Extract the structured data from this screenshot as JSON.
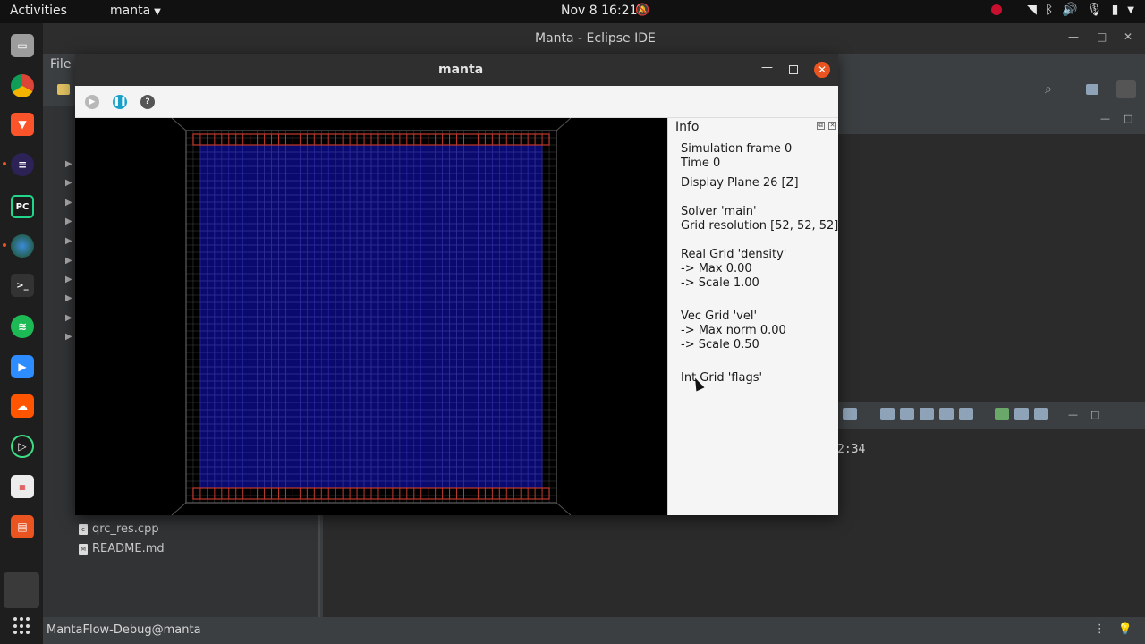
{
  "topbar": {
    "activities": "Activities",
    "app_menu": "manta",
    "clock": "Nov 8  16:21"
  },
  "eclipse": {
    "title": "Manta - Eclipse IDE",
    "menu_file": "File",
    "explorer_files": [
      {
        "name": "qrc_res.cpp",
        "icon": "c-file-icon"
      },
      {
        "name": "README.md",
        "icon": "md-file-icon"
      }
    ],
    "console_time": "2:34",
    "status": "MantaFlow-Debug@manta"
  },
  "manta": {
    "title": "manta",
    "info_title": "Info",
    "info_lines": [
      "Simulation frame 0",
      "Time 0",
      "Display Plane 26 [Z]",
      "Solver 'main'",
      "Grid resolution [52, 52, 52]",
      "Real Grid 'density'",
      "-> Max 0.00",
      "-> Scale 1.00",
      "Vec Grid 'vel'",
      "-> Max norm 0.00",
      "-> Scale 0.50",
      "Int Grid 'flags'"
    ],
    "grid_resolution": 52
  },
  "colors": {
    "grid_fill": "#0a0a6e",
    "grid_line": "#2c2cb0",
    "boundary": "#c0392b",
    "outer_line": "#707070",
    "accent": "#e95420"
  }
}
